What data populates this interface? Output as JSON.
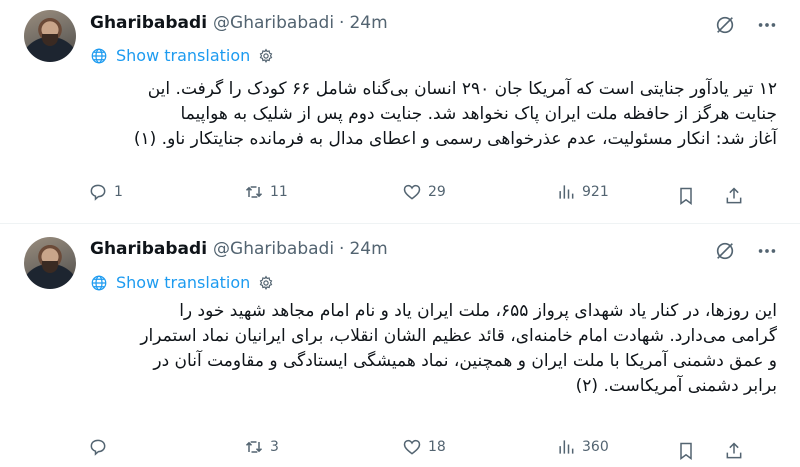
{
  "tweets": [
    {
      "name": "Gharibabadi",
      "handle": "@Gharibabadi",
      "separator": "·",
      "time": "24m",
      "show_translation": "Show translation",
      "text_lines": [
        "۱۲ تیر یادآور جنایتی است که آمریکا جان ۲۹۰ انسان بی‌گناه شامل ۶۶ کودک را گرفت. این",
        "جنایت هرگز از حافظه ملت ایران پاک نخواهد شد. جنایت دوم پس از شلیک به هواپیما",
        "آغاز شد: انکار مسئولیت، عدم عذرخواهی رسمی و اعطای مدال به فرمانده جنایتکار ناو. (۱)"
      ],
      "replies": "1",
      "reposts": "11",
      "likes": "29",
      "views": "921"
    },
    {
      "name": "Gharibabadi",
      "handle": "@Gharibabadi",
      "separator": "·",
      "time": "24m",
      "show_translation": "Show translation",
      "text_lines": [
        "این روزها، در کنار یاد شهدای پرواز ۶۵۵، ملت ایران یاد و نام امام مجاهد شهید خود را",
        "گرامی می‌دارد. شهادت امام خامنه‌ای، قائد عظیم الشان انقلاب، برای ایرانیان نماد استمرار",
        "و عمق دشمنی آمریکا با ملت ایران و همچنین، نماد همیشگی ایستادگی و مقاومت آنان در",
        "برابر دشمنی آمریکاست. (۲)"
      ],
      "replies": "",
      "reposts": "3",
      "likes": "18",
      "views": "360"
    }
  ],
  "icons": {
    "grok": "grok-icon",
    "more": "more-icon",
    "globe": "globe-icon",
    "gear": "gear-icon",
    "reply": "reply-icon",
    "repost": "repost-icon",
    "like": "like-icon",
    "views": "views-icon",
    "bookmark": "bookmark-icon",
    "share": "share-icon"
  },
  "colors": {
    "link": "#1d9bf0",
    "secondary": "#536471",
    "text": "#0f1419"
  }
}
